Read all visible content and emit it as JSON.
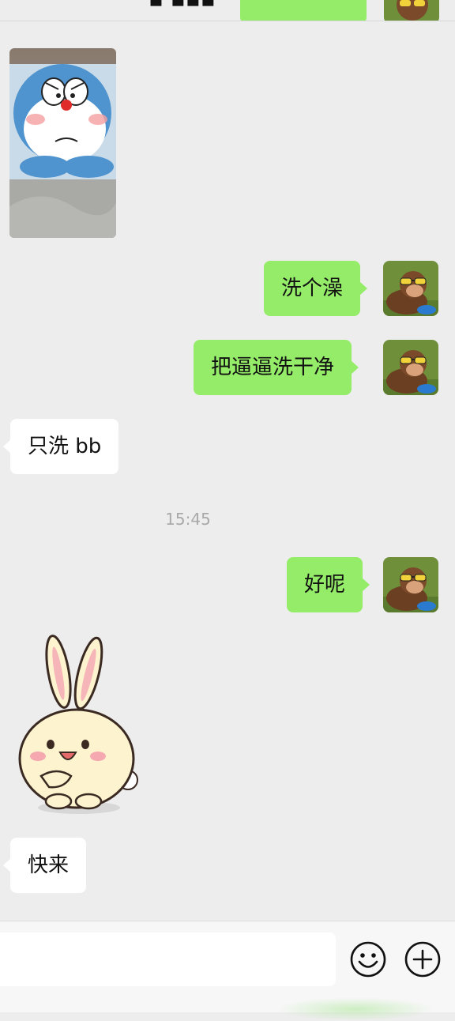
{
  "messages": [
    {
      "direction": "in",
      "type": "image",
      "description": "doraemon-photo"
    },
    {
      "direction": "out",
      "type": "text",
      "text": "洗个澡"
    },
    {
      "direction": "out",
      "type": "text",
      "text": "把逼逼洗干净"
    },
    {
      "direction": "in",
      "type": "text",
      "text": "只洗 bb"
    },
    {
      "direction": "out",
      "type": "text",
      "text": "好呢"
    },
    {
      "direction": "in",
      "type": "sticker",
      "description": "bunny-sticker"
    },
    {
      "direction": "in",
      "type": "text",
      "text": "快来"
    }
  ],
  "timestamp": "15:45",
  "input": {
    "value": "",
    "placeholder": ""
  },
  "icons": {
    "emoji": "smiley-face-icon",
    "plus": "plus-circle-icon",
    "avatar": "monkey-avatar-icon"
  },
  "colors": {
    "background": "#ededed",
    "outgoing_bubble": "#95ec69",
    "incoming_bubble": "#ffffff",
    "timestamp": "#a9a9a9"
  }
}
